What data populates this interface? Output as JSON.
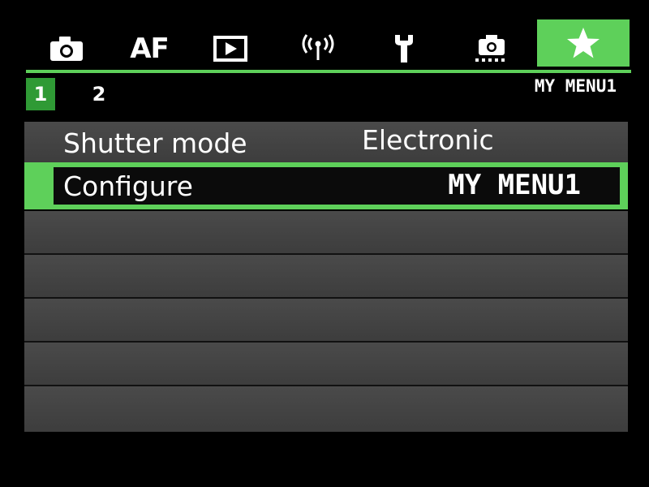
{
  "tabs": [
    {
      "icon": "camera-icon",
      "label": ""
    },
    {
      "icon": "af-icon",
      "label": "AF"
    },
    {
      "icon": "play-icon",
      "label": ""
    },
    {
      "icon": "wireless-icon",
      "label": ""
    },
    {
      "icon": "wrench-icon",
      "label": ""
    },
    {
      "icon": "custom-function-icon",
      "label": ""
    },
    {
      "icon": "star-icon",
      "label": "",
      "active": true
    }
  ],
  "subtabs": [
    "1",
    "2"
  ],
  "active_subtab": "1",
  "menu_name": "MY MENU1",
  "menu_items": [
    {
      "label": "Shutter mode",
      "value": "Electronic",
      "selected": false
    },
    {
      "label": "Configure",
      "value": "MY MENU1",
      "selected": true
    }
  ],
  "colors": {
    "accent": "#5ed05a",
    "subtab_active": "#2f9a35",
    "row_bg": "#444444",
    "background": "#000000"
  }
}
